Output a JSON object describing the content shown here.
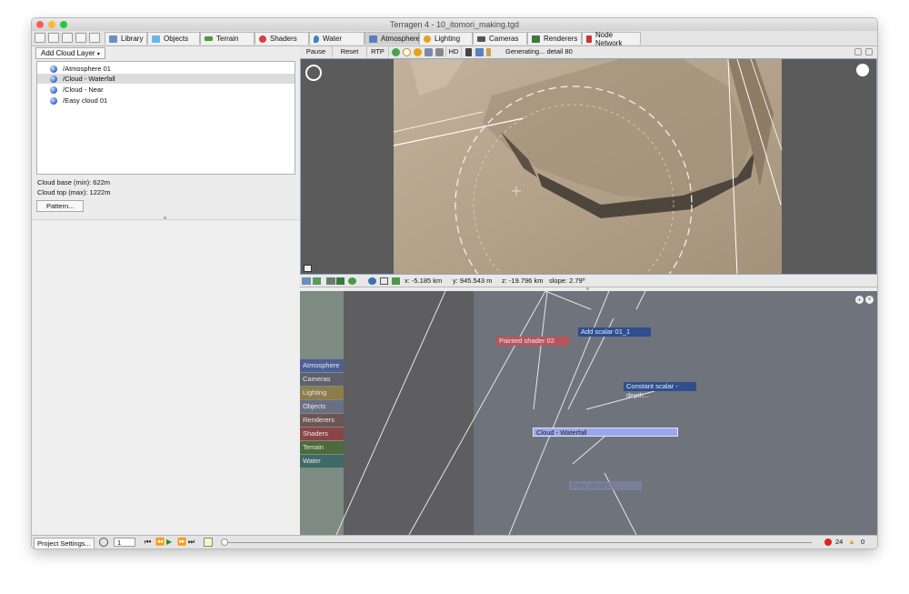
{
  "window": {
    "title": "Terragen 4 - 10_itomori_making.tgd",
    "traffic_colors": [
      "#fc5f57",
      "#fdbc2e",
      "#28c840"
    ]
  },
  "tabs": [
    {
      "label": "Library",
      "icon": "library-icon",
      "color": "#6a8ec9"
    },
    {
      "label": "Objects",
      "icon": "cube-icon",
      "color": "#6cb6e6"
    },
    {
      "label": "Terrain",
      "icon": "terrain-icon",
      "color": "#4d9a3c"
    },
    {
      "label": "Shaders",
      "icon": "sphere-icon",
      "color": "#d34040"
    },
    {
      "label": "Water",
      "icon": "water-drop-icon",
      "color": "#3b82c8"
    },
    {
      "label": "Atmosphere",
      "icon": "cloud-icon",
      "color": "#5a7fc2"
    },
    {
      "label": "Lighting",
      "icon": "sun-icon",
      "color": "#e8a21a"
    },
    {
      "label": "Cameras",
      "icon": "camera-icon",
      "color": "#555555"
    },
    {
      "label": "Renderers",
      "icon": "image-icon",
      "color": "#3b7a3b"
    },
    {
      "label": "Node Network",
      "icon": "network-icon",
      "color": "#cc3333"
    }
  ],
  "left": {
    "add_cloud_label": "Add Cloud Layer",
    "layers": [
      {
        "name": "/Atmosphere 01",
        "selected": false
      },
      {
        "name": "/Cloud - Waterfall",
        "selected": true
      },
      {
        "name": "/Cloud - Near",
        "selected": false
      },
      {
        "name": "/Easy cloud 01",
        "selected": false
      }
    ],
    "cloud_base": "Cloud base (min): 622m",
    "cloud_top": "Cloud top (max): 1222m",
    "pattern_label": "Pattern..."
  },
  "viewport": {
    "pause_label": "Pause",
    "reset_label": "Reset",
    "rtp_label": "RTP",
    "hd_label": "HD",
    "status": "Generating... detail 80"
  },
  "coords": {
    "x": "x: -5.185 km",
    "y": "y: 945.543 m",
    "z": "z: -19.796 km",
    "slope": "slope: 2.79º"
  },
  "node_palette": [
    {
      "label": "Atmosphere",
      "color": "#4c5f96"
    },
    {
      "label": "Cameras",
      "color": "#60606c"
    },
    {
      "label": "Lighting",
      "color": "#8d7d4b"
    },
    {
      "label": "Objects",
      "color": "#6a7084"
    },
    {
      "label": "Renderers",
      "color": "#6f5454"
    },
    {
      "label": "Shaders",
      "color": "#8c4545"
    },
    {
      "label": "Terrain",
      "color": "#4c6a3a"
    },
    {
      "label": "Water",
      "color": "#3f6a66"
    }
  ],
  "nodes": {
    "painted_shader": "Painted shader 02",
    "add_scalar": "Add scalar 01_1",
    "constant_scalar": "Constant scalar - depth...",
    "cloud_waterfall": "Cloud - Waterfall",
    "easy_cloud": "Easy cloud 01"
  },
  "bottom": {
    "project_settings": "Project Settings...",
    "frame_value": "1",
    "error_count": "24",
    "warning_count": "0"
  }
}
